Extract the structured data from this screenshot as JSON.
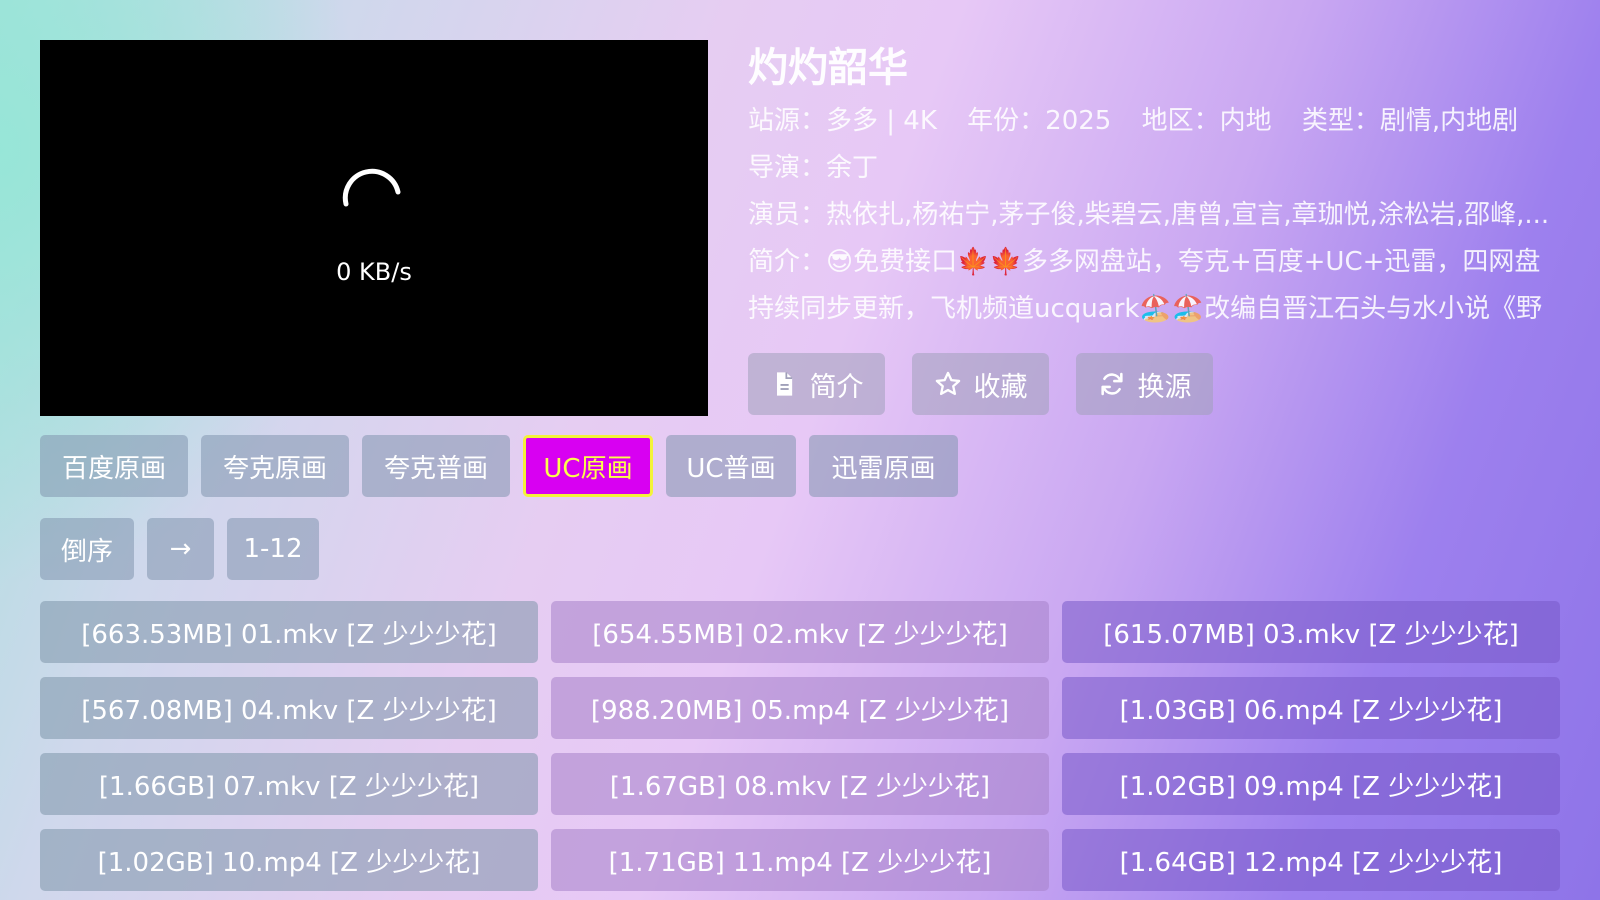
{
  "player": {
    "speed": "0 KB/s"
  },
  "detail": {
    "title": "灼灼韶华",
    "meta": {
      "source": "站源：多多 | 4K",
      "year": "年份：2025",
      "region": "地区：内地",
      "genre": "类型：剧情,内地剧"
    },
    "director": "导演：余丁",
    "actors": "演员：热依扎,杨祐宁,茅子俊,柴碧云,唐曾,宣言,章珈悦,涂松岩,邵峰,...",
    "intro_line1": "简介：😎免费接口🍁🍁多多网盘站，夸克+百度+UC+迅雷，四网盘",
    "intro_line2": "持续同步更新，飞机频道ucquark🏖️🏖️改编自晋江石头与水小说《野"
  },
  "actions": {
    "intro": "简介",
    "favorite": "收藏",
    "switch_source": "换源"
  },
  "sources": [
    "百度原画",
    "夸克原画",
    "夸克普画",
    "UC原画",
    "UC普画",
    "迅雷原画"
  ],
  "controls": {
    "reverse": "倒序",
    "arrow": "→",
    "range": "1-12"
  },
  "episodes": [
    "[663.53MB] 01.mkv [Z 少少少花]",
    "[654.55MB] 02.mkv [Z 少少少花]",
    "[615.07MB] 03.mkv [Z 少少少花]",
    "[567.08MB] 04.mkv [Z 少少少花]",
    "[988.20MB] 05.mp4 [Z 少少少花]",
    "[1.03GB] 06.mp4 [Z 少少少花]",
    "[1.66GB] 07.mkv [Z 少少少花]",
    "[1.67GB] 08.mkv [Z 少少少花]",
    "[1.02GB] 09.mp4 [Z 少少少花]",
    "[1.02GB] 10.mp4 [Z 少少少花]",
    "[1.71GB] 11.mp4 [Z 少少少花]",
    "[1.64GB] 12.mp4 [Z 少少少花]"
  ],
  "colors": {
    "active_chip_bg": "#d800f2",
    "active_chip_text": "#fbff4a",
    "active_chip_border": "#f3f33a"
  },
  "icons": {
    "intro": "document-icon",
    "favorite": "star-icon",
    "switch_source": "refresh-icon",
    "loading": "loading-spinner-icon"
  }
}
